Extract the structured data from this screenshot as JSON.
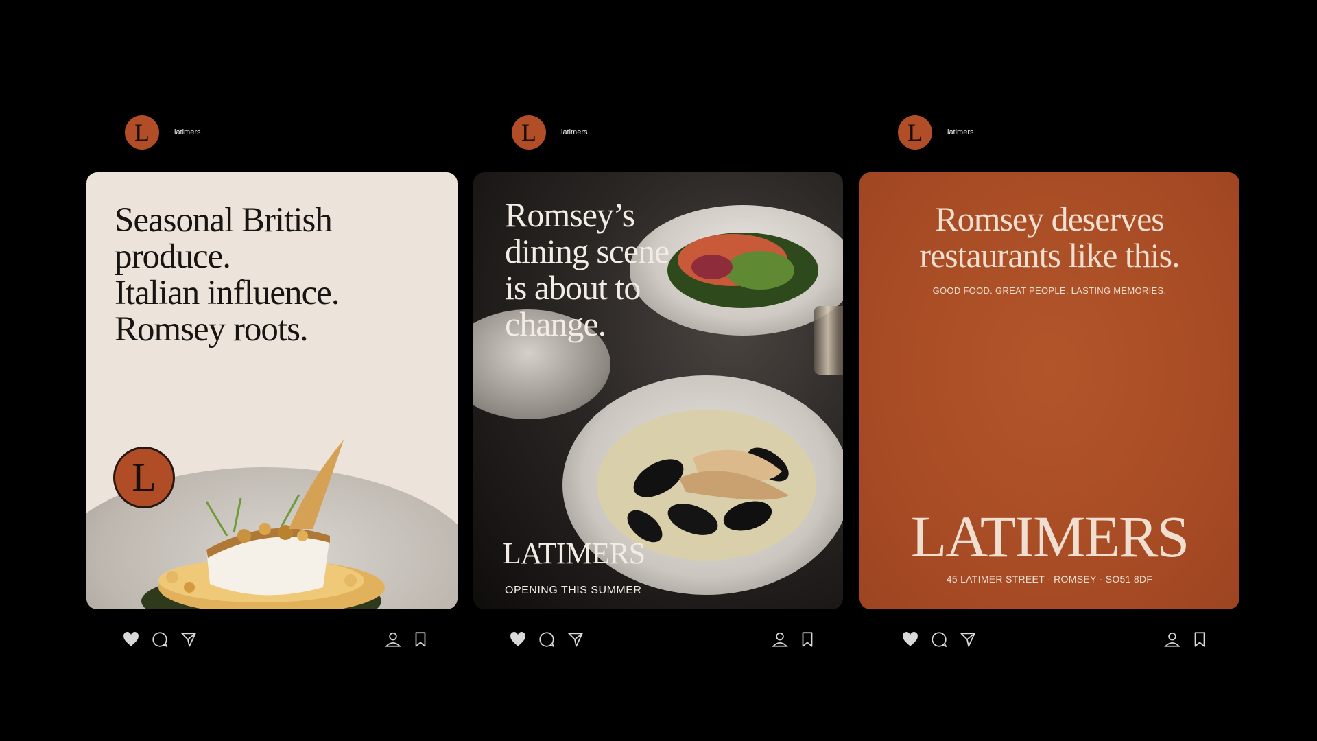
{
  "posts": [
    {
      "username": "latimers",
      "avatar_letter": "L",
      "headline": [
        "Seasonal British",
        "produce.",
        "Italian influence.",
        "Romsey roots."
      ],
      "badge_letter": "L",
      "icons": [
        "heart-icon",
        "comment-icon",
        "share-icon",
        "profile-icon",
        "bookmark-icon"
      ]
    },
    {
      "username": "latimers",
      "avatar_letter": "L",
      "headline": [
        "Romsey’s",
        "dining scene",
        "is about to",
        "change."
      ],
      "wordmark": "LATIMERS",
      "subline": "OPENING THIS SUMMER",
      "icons": [
        "heart-icon",
        "comment-icon",
        "share-icon",
        "profile-icon",
        "bookmark-icon"
      ]
    },
    {
      "username": "latimers",
      "avatar_letter": "L",
      "headline": [
        "Romsey deserves",
        "restaurants like this."
      ],
      "tagline": "GOOD FOOD. GREAT PEOPLE. LASTING MEMORIES.",
      "wordmark": "LATIMERS",
      "address": "45 LATIMER STREET · ROMSEY · SO51 8DF",
      "icons": [
        "heart-icon",
        "comment-icon",
        "share-icon",
        "profile-icon",
        "bookmark-icon"
      ]
    }
  ],
  "colors": {
    "background": "#000000",
    "brand_terracotta": "#b04d27",
    "cream": "#ece4da",
    "text_light": "#f0dfd0",
    "heart": "#d9d9d9"
  }
}
